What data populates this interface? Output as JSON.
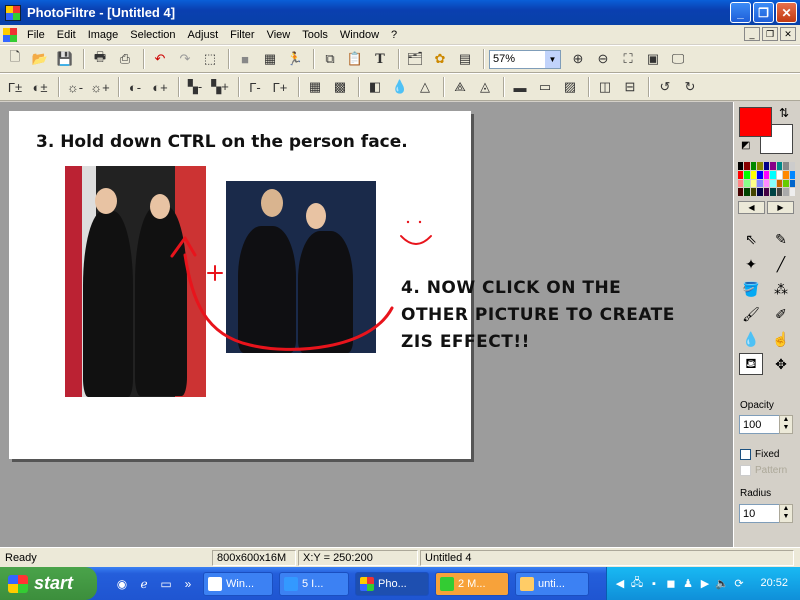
{
  "window": {
    "title": "PhotoFiltre - [Untitled 4]",
    "controls": [
      "_",
      "❐",
      "✕"
    ]
  },
  "menu": {
    "items": [
      "File",
      "Edit",
      "Image",
      "Selection",
      "Adjust",
      "Filter",
      "View",
      "Tools",
      "Window",
      "?"
    ]
  },
  "toolbar": {
    "zoom_value": "57%"
  },
  "canvas": {
    "step3": "3. Hold down  CTRL on the person face.",
    "step4_lines": [
      "4. NOW CLICK ON THE",
      "OTHER PICTURE TO CREATE",
      "ZIS EFFECT!!"
    ],
    "annotation_color": "#e8141c"
  },
  "colors": {
    "foreground": "#ff0000",
    "background": "#ffffff"
  },
  "options": {
    "opacity_label": "Opacity",
    "opacity_value": "100",
    "fixed_label": "Fixed",
    "pattern_label": "Pattern",
    "radius_label": "Radius",
    "radius_value": "10"
  },
  "status": {
    "ready": "Ready",
    "size": "800x600x16M",
    "coords": "X:Y = 250:200",
    "doc": "Untitled 4"
  },
  "taskbar": {
    "start_label": "start",
    "tasks": [
      "Win...",
      "5 I...",
      "Pho...",
      "2 M...",
      "unti..."
    ],
    "clock": "20:52"
  }
}
